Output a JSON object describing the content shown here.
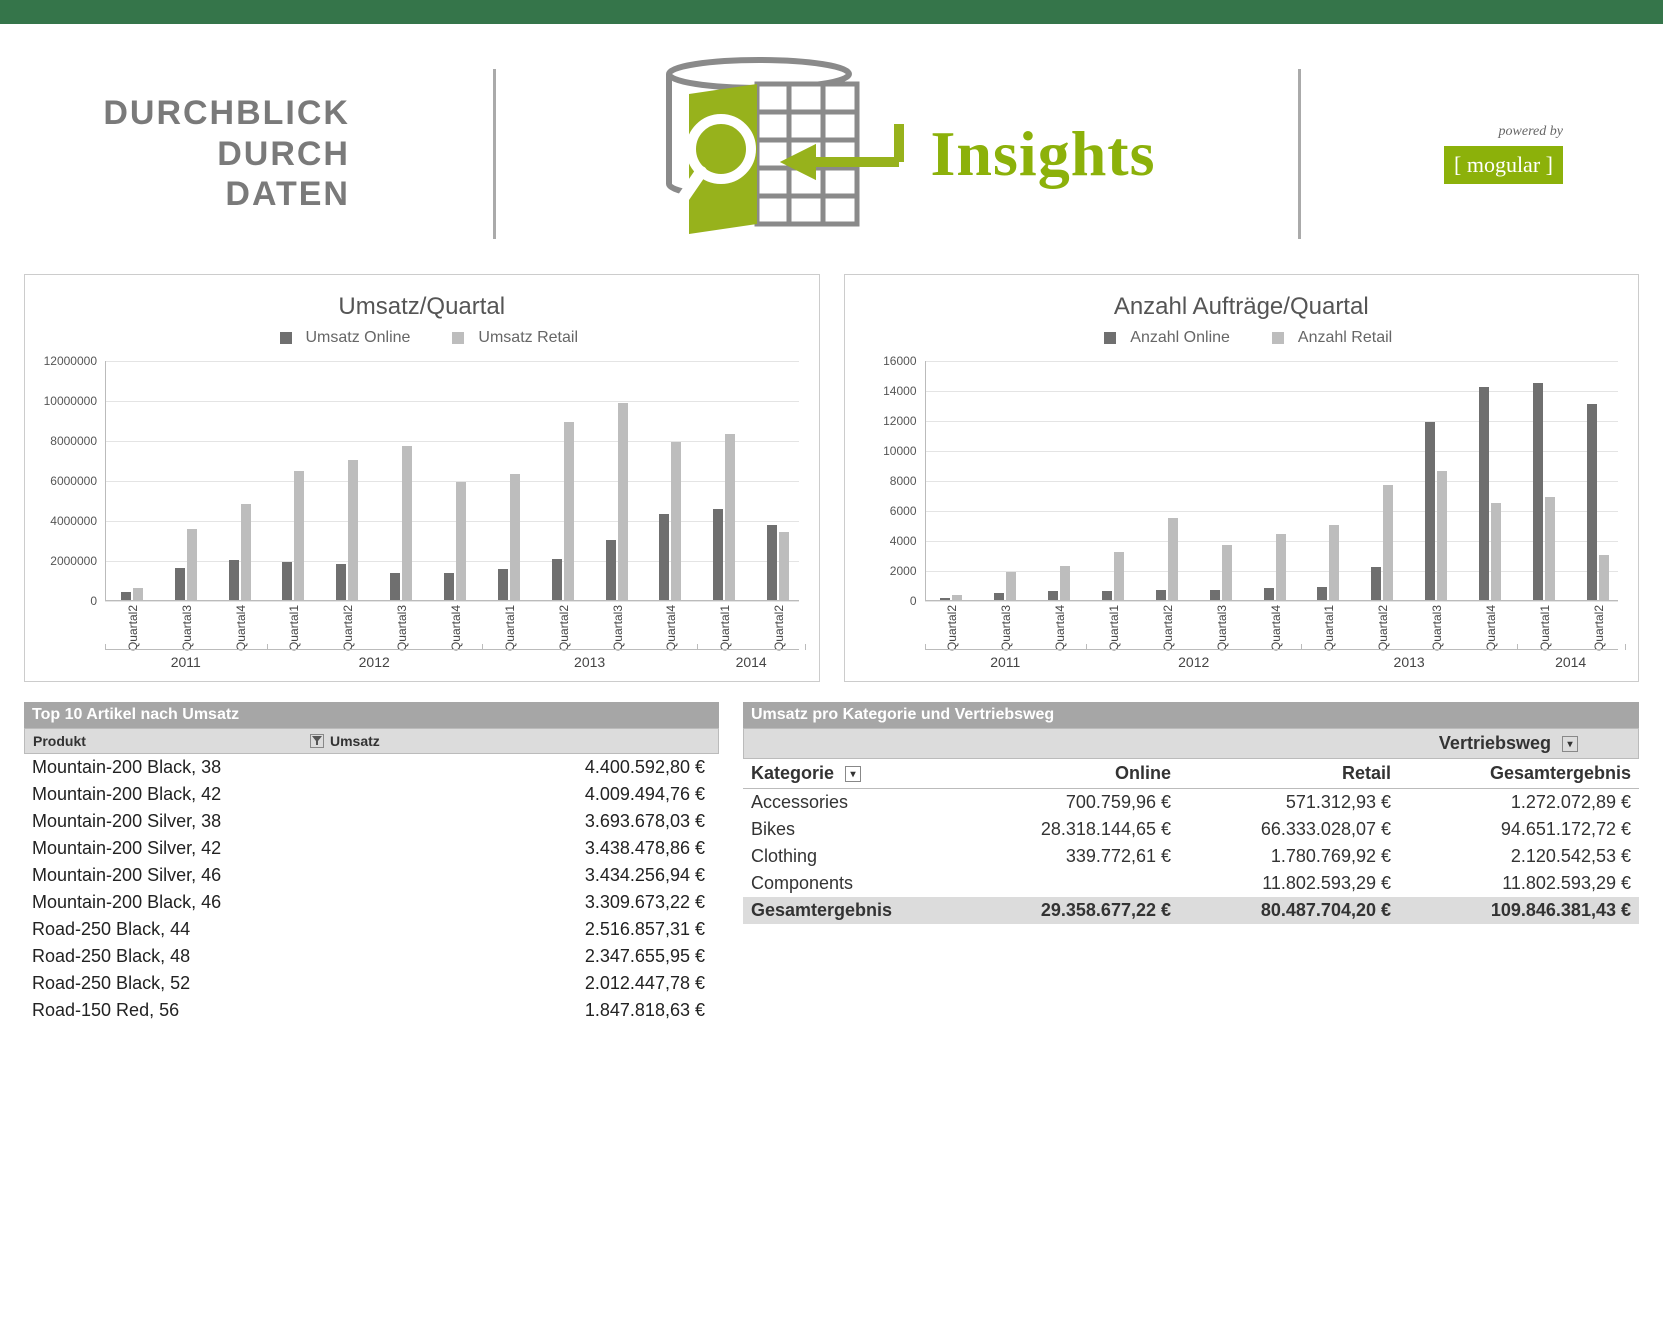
{
  "header": {
    "tagline_l1": "DURCHBLICK",
    "tagline_l2": "DURCH",
    "tagline_l3": "DATEN",
    "brand": "Insights",
    "powered_label": "powered by",
    "mogular": "[ mogular ]"
  },
  "chart_data": [
    {
      "type": "bar",
      "title": "Umsatz/Quartal",
      "legend": [
        "Umsatz Online",
        "Umsatz Retail"
      ],
      "categories": [
        {
          "year": "2011",
          "q": "Quartal2"
        },
        {
          "year": "2011",
          "q": "Quartal3"
        },
        {
          "year": "2011",
          "q": "Quartal4"
        },
        {
          "year": "2012",
          "q": "Quartal1"
        },
        {
          "year": "2012",
          "q": "Quartal2"
        },
        {
          "year": "2012",
          "q": "Quartal3"
        },
        {
          "year": "2012",
          "q": "Quartal4"
        },
        {
          "year": "2013",
          "q": "Quartal1"
        },
        {
          "year": "2013",
          "q": "Quartal2"
        },
        {
          "year": "2013",
          "q": "Quartal3"
        },
        {
          "year": "2013",
          "q": "Quartal4"
        },
        {
          "year": "2014",
          "q": "Quartal1"
        },
        {
          "year": "2014",
          "q": "Quartal2"
        }
      ],
      "series": [
        {
          "name": "Umsatz Online",
          "values": [
            400000,
            1600000,
            2000000,
            1900000,
            1800000,
            1350000,
            1350000,
            1550000,
            2050000,
            3000000,
            4300000,
            4550000,
            3750000
          ]
        },
        {
          "name": "Umsatz Retail",
          "values": [
            600000,
            3550000,
            4800000,
            6450000,
            7000000,
            7700000,
            5900000,
            6300000,
            8900000,
            9850000,
            7900000,
            8300000,
            3400000
          ]
        }
      ],
      "ymax": 12000000,
      "ystep": 2000000
    },
    {
      "type": "bar",
      "title": "Anzahl Aufträge/Quartal",
      "legend": [
        "Anzahl Online",
        "Anzahl Retail"
      ],
      "categories": [
        {
          "year": "2011",
          "q": "Quartal2"
        },
        {
          "year": "2011",
          "q": "Quartal3"
        },
        {
          "year": "2011",
          "q": "Quartal4"
        },
        {
          "year": "2012",
          "q": "Quartal1"
        },
        {
          "year": "2012",
          "q": "Quartal2"
        },
        {
          "year": "2012",
          "q": "Quartal3"
        },
        {
          "year": "2012",
          "q": "Quartal4"
        },
        {
          "year": "2013",
          "q": "Quartal1"
        },
        {
          "year": "2013",
          "q": "Quartal2"
        },
        {
          "year": "2013",
          "q": "Quartal3"
        },
        {
          "year": "2013",
          "q": "Quartal4"
        },
        {
          "year": "2014",
          "q": "Quartal1"
        },
        {
          "year": "2014",
          "q": "Quartal2"
        }
      ],
      "series": [
        {
          "name": "Anzahl Online",
          "values": [
            150,
            500,
            600,
            600,
            700,
            700,
            800,
            900,
            2200,
            11900,
            14200,
            14500,
            13100
          ]
        },
        {
          "name": "Anzahl Retail",
          "values": [
            350,
            1900,
            2300,
            3200,
            5500,
            3700,
            4400,
            5000,
            7700,
            8600,
            6500,
            6900,
            3000
          ]
        }
      ],
      "ymax": 16000,
      "ystep": 2000
    }
  ],
  "top10": {
    "title": "Top 10 Artikel nach Umsatz",
    "col_produkt": "Produkt",
    "col_umsatz": "Umsatz",
    "rows": [
      {
        "produkt": "Mountain-200 Black, 38",
        "umsatz": "4.400.592,80 €"
      },
      {
        "produkt": "Mountain-200 Black, 42",
        "umsatz": "4.009.494,76 €"
      },
      {
        "produkt": "Mountain-200 Silver, 38",
        "umsatz": "3.693.678,03 €"
      },
      {
        "produkt": "Mountain-200 Silver, 42",
        "umsatz": "3.438.478,86 €"
      },
      {
        "produkt": "Mountain-200 Silver, 46",
        "umsatz": "3.434.256,94 €"
      },
      {
        "produkt": "Mountain-200 Black, 46",
        "umsatz": "3.309.673,22 €"
      },
      {
        "produkt": "Road-250 Black, 44",
        "umsatz": "2.516.857,31 €"
      },
      {
        "produkt": "Road-250 Black, 48",
        "umsatz": "2.347.655,95 €"
      },
      {
        "produkt": "Road-250 Black, 52",
        "umsatz": "2.012.447,78 €"
      },
      {
        "produkt": "Road-150 Red, 56",
        "umsatz": "1.847.818,63 €"
      }
    ]
  },
  "pivot": {
    "title": "Umsatz pro Kategorie und Vertriebsweg",
    "col_header": "Vertriebsweg",
    "row_header": "Kategorie",
    "cols": [
      "Online",
      "Retail",
      "Gesamtergebnis"
    ],
    "rows": [
      {
        "k": "Accessories",
        "v": [
          "700.759,96 €",
          "571.312,93 €",
          "1.272.072,89 €"
        ]
      },
      {
        "k": "Bikes",
        "v": [
          "28.318.144,65 €",
          "66.333.028,07 €",
          "94.651.172,72 €"
        ]
      },
      {
        "k": "Clothing",
        "v": [
          "339.772,61 €",
          "1.780.769,92 €",
          "2.120.542,53 €"
        ]
      },
      {
        "k": "Components",
        "v": [
          "",
          "11.802.593,29 €",
          "11.802.593,29 €"
        ]
      }
    ],
    "total_label": "Gesamtergebnis",
    "totals": [
      "29.358.677,22 €",
      "80.487.704,20 €",
      "109.846.381,43 €"
    ]
  }
}
